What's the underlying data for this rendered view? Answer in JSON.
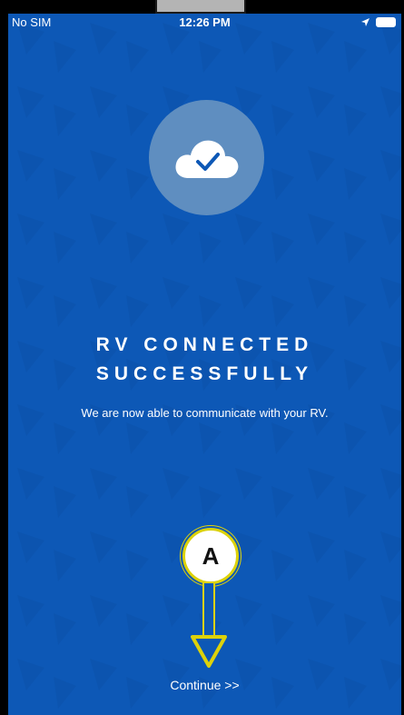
{
  "status_bar": {
    "carrier": "No SIM",
    "time": "12:26 PM"
  },
  "success": {
    "headline_line1": "RV CONNECTED",
    "headline_line2": "SUCCESSFULLY",
    "message": "We are now able to communicate with your RV."
  },
  "annotation": {
    "label": "A"
  },
  "continue_label": "Continue >>",
  "colors": {
    "background": "#0d58b6",
    "icon_circle": "#5f8ec0",
    "callout_border": "#ddd20a"
  },
  "icons": [
    "location-arrow-icon",
    "battery-icon",
    "cloud-check-icon",
    "annotation-arrow-icon"
  ]
}
